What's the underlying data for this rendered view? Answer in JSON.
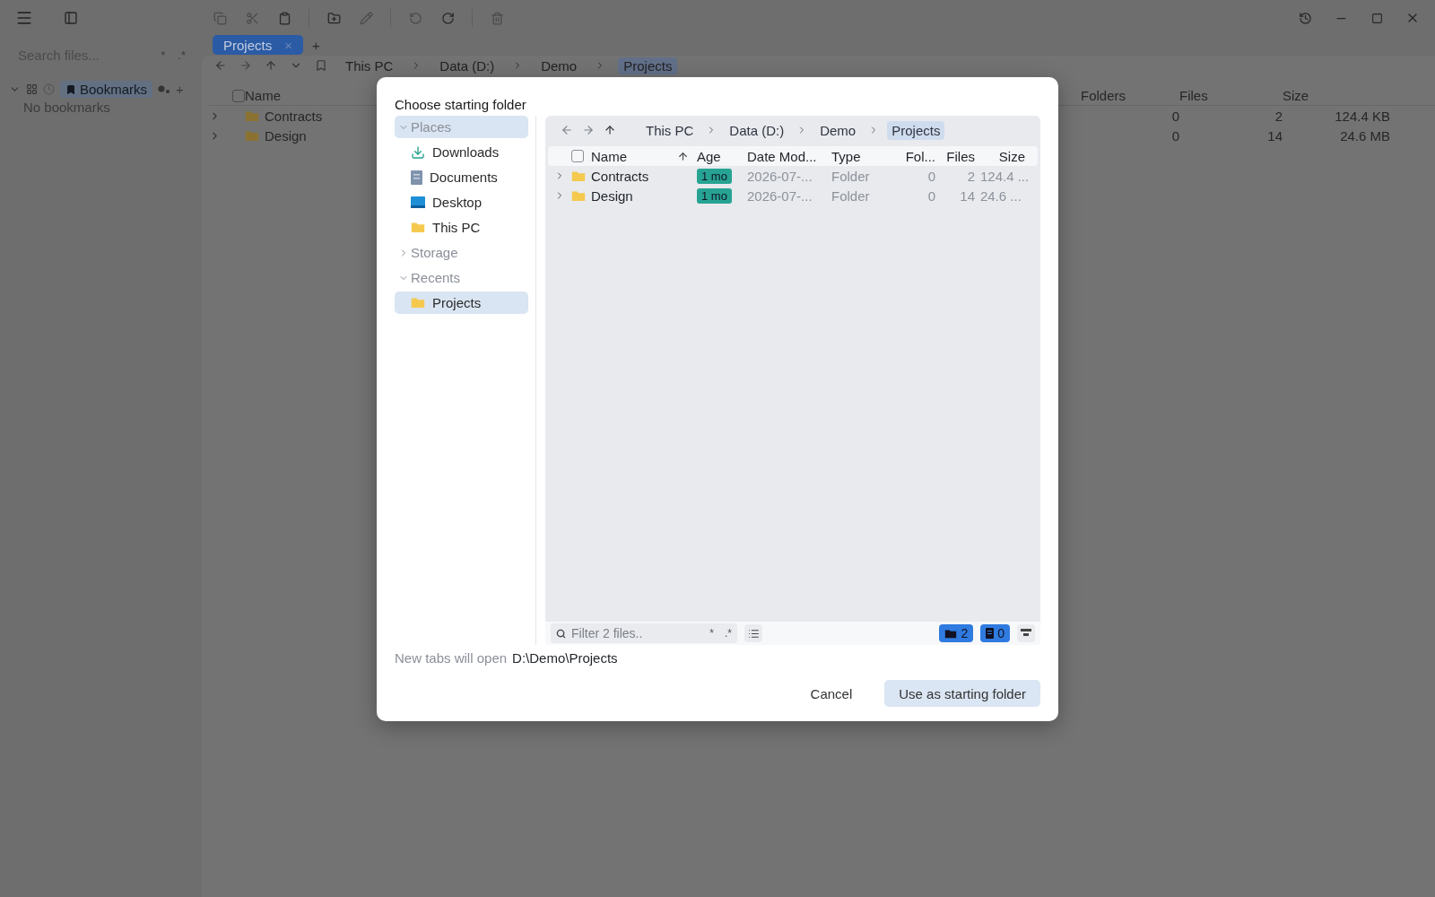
{
  "sidebar": {
    "search_placeholder": "Search files...",
    "search_options": [
      "*",
      ".*"
    ],
    "bookmarks_label": "Bookmarks",
    "add": "+",
    "empty_text": "No bookmarks"
  },
  "tabs": [
    {
      "label": "Projects",
      "selected": true,
      "close": "×"
    }
  ],
  "add_tab": "+",
  "breadcrumb": [
    "This PC",
    "Data (D:)",
    "Demo",
    "Projects"
  ],
  "table": {
    "header_checked": false,
    "columns": [
      "Name",
      "Folders",
      "Files",
      "Size"
    ],
    "rows": [
      {
        "name": "Contracts",
        "expanded": false,
        "folders": "0",
        "files": "2",
        "size": "124.4 KB"
      },
      {
        "name": "Design",
        "expanded": false,
        "folders": "0",
        "files": "14",
        "size": "24.6 MB"
      }
    ]
  },
  "dialog": {
    "title": "Choose starting folder",
    "places": [
      {
        "label": "Places",
        "expanded": true,
        "selected": true,
        "children": [
          {
            "label": "Downloads",
            "kind": "download",
            "selected": false
          },
          {
            "label": "Documents",
            "kind": "document",
            "selected": false
          },
          {
            "label": "Desktop",
            "kind": "desktop",
            "selected": false
          },
          {
            "label": "This PC",
            "kind": "folder",
            "selected": false
          }
        ]
      },
      {
        "label": "Storage",
        "expanded": false,
        "selected": false
      },
      {
        "label": "Recents",
        "expanded": true,
        "selected": false,
        "children": [
          {
            "label": "Projects",
            "kind": "folder",
            "selected": true
          }
        ]
      }
    ],
    "breadcrumb": [
      "This PC",
      "Data (D:)",
      "Demo",
      "Projects"
    ],
    "header_checked": false,
    "columns": [
      "Name",
      "Age",
      "Date Mod...",
      "Type",
      "Fol...",
      "Files",
      "Size"
    ],
    "rows": [
      {
        "name": "Contracts",
        "expanded": false,
        "age": "1 mo",
        "date": "2026-07-...",
        "type": "Folder",
        "folders": "0",
        "files": "2",
        "size": "124.4 ..."
      },
      {
        "name": "Design",
        "expanded": false,
        "age": "1 mo",
        "date": "2026-07-...",
        "type": "Folder",
        "folders": "0",
        "files": "14",
        "size": "24.6 ..."
      }
    ],
    "filter_placeholder": "Filter 2 files..",
    "filter_options": [
      "*",
      ".*"
    ],
    "folder_count": "2",
    "file_count": "0",
    "target_label": "New tabs will open",
    "target_path": "D:\\Demo\\Projects",
    "buttons": [
      {
        "label": "Cancel",
        "kind": "secondary"
      },
      {
        "label": "Use as starting folder",
        "kind": "primary"
      }
    ]
  }
}
